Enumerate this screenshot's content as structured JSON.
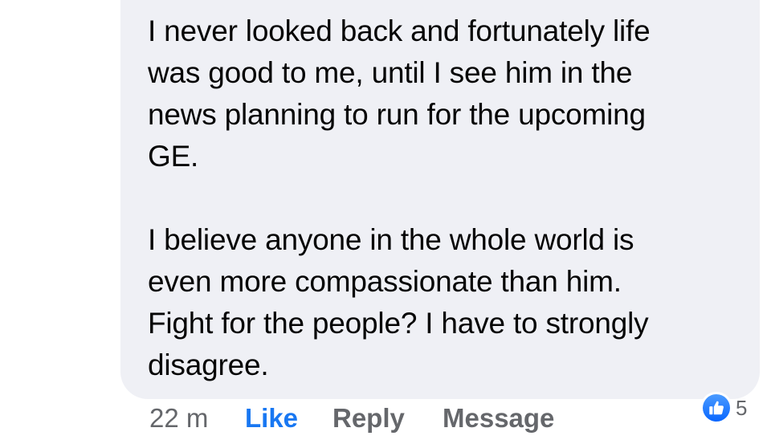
{
  "comment": {
    "paragraph1": [
      "I never looked back and fortunately life",
      "was good to me, until I see him in the",
      "news planning to run for the upcoming",
      "GE."
    ],
    "paragraph2": [
      "I believe anyone in the whole world is",
      "even more compassionate than him.",
      "Fight for the people? I have to strongly",
      "disagree."
    ]
  },
  "actions": {
    "timestamp": "22 m",
    "like_label": "Like",
    "reply_label": "Reply",
    "message_label": "Message"
  },
  "reactions": {
    "icon": "thumbs-up-icon",
    "count": "5"
  },
  "colors": {
    "bubble": "#eff0f5",
    "text": "#050505",
    "muted": "#65676b",
    "like_blue": "#1877f2"
  }
}
